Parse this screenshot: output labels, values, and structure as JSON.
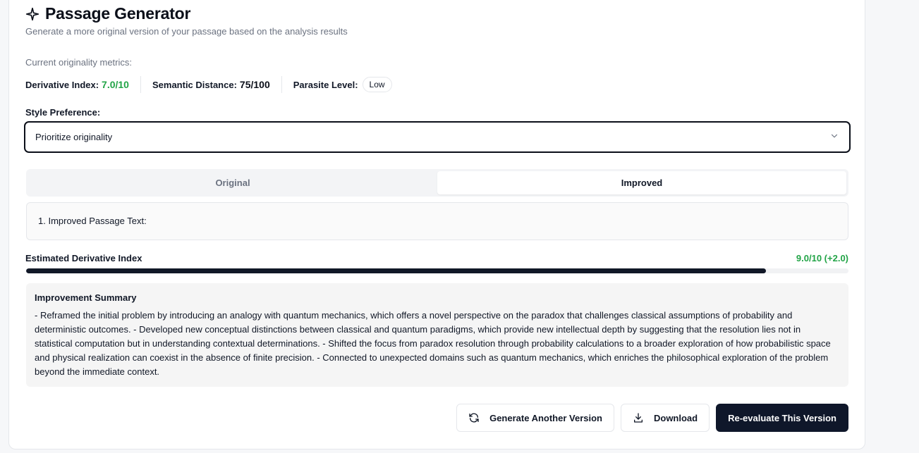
{
  "header": {
    "title": "Passage Generator",
    "subtitle": "Generate a more original version of your passage based on the analysis results",
    "icon": "sparkle-icon"
  },
  "metrics": {
    "label": "Current originality metrics:",
    "derivative_label": "Derivative Index:",
    "derivative_value": "7.0/10",
    "semantic_label": "Semantic Distance:",
    "semantic_value": "75/100",
    "parasite_label": "Parasite Level:",
    "parasite_value": "Low",
    "colors": {
      "good": "#22a447"
    }
  },
  "style": {
    "label": "Style Preference:",
    "selected": "Prioritize originality"
  },
  "tabs": [
    {
      "label": "Original",
      "active": false
    },
    {
      "label": "Improved",
      "active": true
    }
  ],
  "passage": {
    "text": "1. Improved Passage Text:"
  },
  "estimate": {
    "label": "Estimated Derivative Index",
    "value_text": "9.0/10 (+2.0)",
    "fraction": 0.9
  },
  "summary": {
    "title": "Improvement Summary",
    "body": "- Reframed the initial problem by introducing an analogy with quantum mechanics, which offers a novel perspective on the paradox that challenges classical assumptions of probability and deterministic outcomes. - Developed new conceptual distinctions between classical and quantum paradigms, which provide new intellectual depth by suggesting that the resolution lies not in statistical computation but in understanding contextual determinations. - Shifted the focus from paradox resolution through probability calculations to a broader exploration of how probabilistic space and physical realization can coexist in the absence of finite precision. - Connected to unexpected domains such as quantum mechanics, which enriches the philosophical exploration of the problem beyond the immediate context."
  },
  "actions": {
    "generate_label": "Generate Another Version",
    "download_label": "Download",
    "reevaluate_label": "Re-evaluate This Version"
  }
}
